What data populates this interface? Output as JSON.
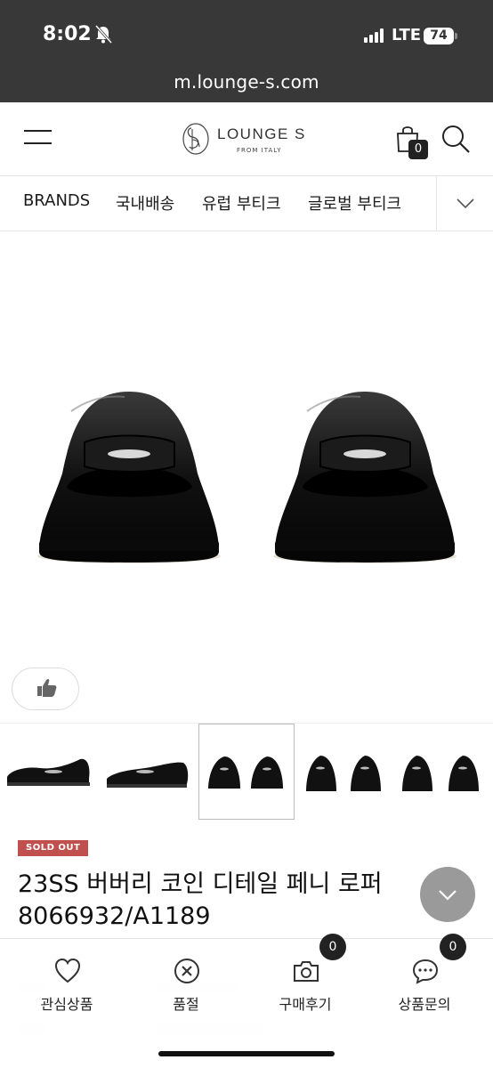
{
  "status_bar": {
    "time": "8:02",
    "network": "LTE",
    "battery": "74"
  },
  "browser": {
    "url": "m.lounge-s.com"
  },
  "header": {
    "logo_text": "LOUNGE S",
    "logo_sub": "FROM ITALY",
    "cart_count": "0"
  },
  "nav": {
    "items": [
      "BRANDS",
      "국내배송",
      "유럽 부티크",
      "글로벌 부티크"
    ]
  },
  "thumbnails": {
    "count": 6,
    "active_index": 2
  },
  "product": {
    "badge": "SOLD OUT",
    "title": "23SS 버버리 코인 디테일 페니 로퍼",
    "code": "8066932/A1189"
  },
  "bottom_bar": {
    "actions": [
      {
        "label": "관심상품",
        "icon": "heart-icon"
      },
      {
        "label": "품절",
        "icon": "x-circle-icon"
      },
      {
        "label": "구매후기",
        "icon": "camera-icon",
        "count": "0"
      },
      {
        "label": "상품문의",
        "icon": "chat-icon",
        "count": "0"
      }
    ]
  },
  "colors": {
    "topbar": "#383838",
    "soldout": "#c0504d",
    "scroll_button": "#9a9a9a"
  }
}
